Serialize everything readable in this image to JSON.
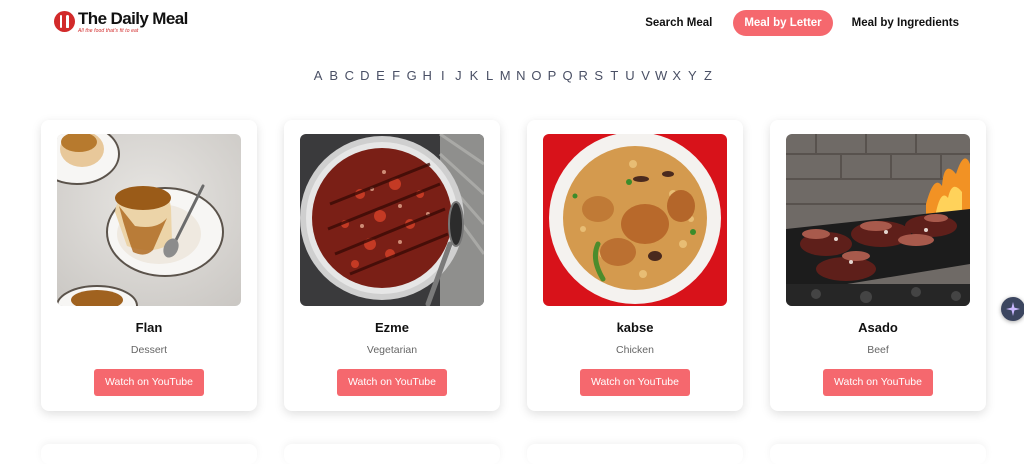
{
  "brand": {
    "name": "The Daily Meal",
    "tagline": "All the food that's fit to eat"
  },
  "nav": [
    {
      "label": "Search Meal",
      "active": false
    },
    {
      "label": "Meal by Letter",
      "active": true
    },
    {
      "label": "Meal by Ingredients",
      "active": false
    }
  ],
  "alphabet": [
    "A",
    "B",
    "C",
    "D",
    "E",
    "F",
    "G",
    "H",
    "I",
    "J",
    "K",
    "L",
    "M",
    "N",
    "O",
    "P",
    "Q",
    "R",
    "S",
    "T",
    "U",
    "V",
    "W",
    "X",
    "Y",
    "Z"
  ],
  "meals": [
    {
      "name": "Flan",
      "category": "Dessert",
      "button": "Watch on YouTube",
      "image": "flan-image"
    },
    {
      "name": "Ezme",
      "category": "Vegetarian",
      "button": "Watch on YouTube",
      "image": "ezme-image"
    },
    {
      "name": "kabse",
      "category": "Chicken",
      "button": "Watch on YouTube",
      "image": "kabse-image"
    },
    {
      "name": "Asado",
      "category": "Beef",
      "button": "Watch on YouTube",
      "image": "asado-image"
    }
  ],
  "colors": {
    "accent": "#f5686e",
    "brand_red": "#d22a2a",
    "letters": "#4a5065"
  },
  "widget": {
    "icon": "sparkle-icon"
  }
}
